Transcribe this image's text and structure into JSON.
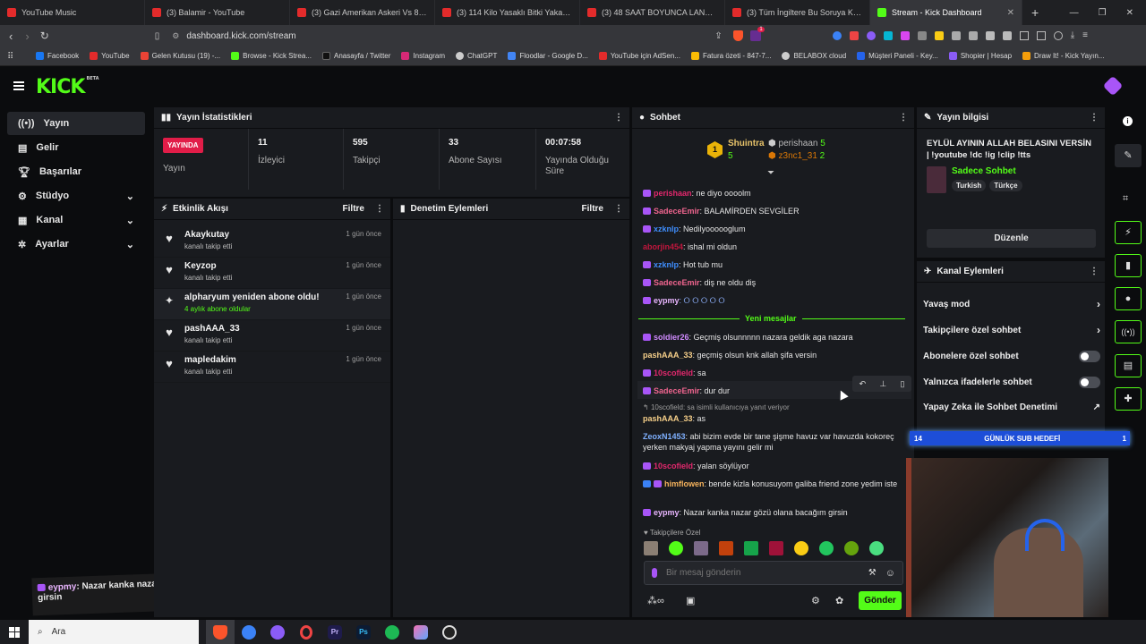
{
  "browser": {
    "tabs": [
      {
        "title": "YouTube Music",
        "active": false
      },
      {
        "title": "(3) Balamir - YouTube",
        "active": false
      },
      {
        "title": "(3) Gazi Amerikan Askeri Vs 8 Polis -",
        "active": false
      },
      {
        "title": "(3) 114 Kilo Yasaklı Bitki Yakalandı | G",
        "active": false
      },
      {
        "title": "(3) 48 SAAT BOYUNCA LANETLİ BİR Ç",
        "active": false
      },
      {
        "title": "(3) Tüm İngiltere Bu Soruya Kilitlend",
        "active": false
      },
      {
        "title": "Stream - Kick Dashboard",
        "active": true
      }
    ],
    "url": "dashboard.kick.com/stream",
    "bookmarks": [
      "Facebook",
      "YouTube",
      "Gelen Kutusu (19) -...",
      "Browse - Kick Strea...",
      "Anasayfa / Twitter",
      "Instagram",
      "ChatGPT",
      "Floodlar - Google D...",
      "YouTube için AdSen...",
      "Fatura özeti - 847-7...",
      "BELABOX cloud",
      "Müşteri Paneli - Key...",
      "Shopier | Hesap",
      "Draw It! - Kick Yayın..."
    ],
    "notification_count": "1"
  },
  "kick": {
    "logo": "KICK",
    "logo_sup": "BETA",
    "brand_color": "#53fc18"
  },
  "sidebar": {
    "items": [
      {
        "label": "Yayın",
        "icon": "broadcast-icon",
        "active": true
      },
      {
        "label": "Gelir",
        "icon": "wallet-icon"
      },
      {
        "label": "Başarılar",
        "icon": "trophy-icon"
      },
      {
        "label": "Stüdyo",
        "icon": "settings-icon",
        "expandable": true
      },
      {
        "label": "Kanal",
        "icon": "channel-icon",
        "expandable": true
      },
      {
        "label": "Ayarlar",
        "icon": "gear-icon",
        "expandable": true
      }
    ]
  },
  "stats": {
    "title": "Yayın İstatistikleri",
    "live_badge": "YAYINDA",
    "live_label": "Yayın",
    "items": [
      {
        "value": "11",
        "label": "İzleyici"
      },
      {
        "value": "595",
        "label": "Takipçi"
      },
      {
        "value": "33",
        "label": "Abone Sayısı"
      },
      {
        "value": "00:07:58",
        "label": "Yayında Olduğu Süre"
      }
    ]
  },
  "activity": {
    "title": "Etkinlik Akışı",
    "filter": "Filtre",
    "items": [
      {
        "name": "Akaykutay",
        "sub": "kanalı takip etti",
        "time": "1 gün önce",
        "icon": "heart-icon"
      },
      {
        "name": "Keyzop",
        "sub": "kanalı takip etti",
        "time": "1 gün önce",
        "icon": "heart-icon"
      },
      {
        "name": "alpharyum yeniden abone oldu!",
        "sub": "4 aylık abone oldular",
        "time": "1 gün önce",
        "icon": "sparkle-icon"
      },
      {
        "name": "pashAAA_33",
        "sub": "kanalı takip etti",
        "time": "1 gün önce",
        "icon": "heart-icon"
      },
      {
        "name": "mapledakim",
        "sub": "kanalı takip etti",
        "time": "1 gün önce",
        "icon": "heart-icon"
      }
    ]
  },
  "moderation": {
    "title": "Denetim Eylemleri",
    "filter": "Filtre"
  },
  "chat": {
    "title": "Sohbet",
    "leaderboard": [
      {
        "rank": "1",
        "name": "Shuintra",
        "count": "5"
      },
      {
        "rank": "",
        "name": "perishaan",
        "count": "5"
      },
      {
        "rank": "",
        "name": "z3nc1_31",
        "count": "2"
      }
    ],
    "messages": [
      {
        "user": "perishaan",
        "color": "#e3286d",
        "text": ": ne diyo oooolm",
        "badge": true
      },
      {
        "user": "SadeceEmir",
        "color": "#f0658f",
        "text": ": BALAMİRDEN SEVGİLER",
        "badge": true
      },
      {
        "user": "xzknlp",
        "color": "#3f8dfc",
        "text": ": Nedilyoooooglum",
        "badge": true
      },
      {
        "user": "aborjin454",
        "color": "#c0163d",
        "text": ": ishal mi oldun",
        "badge": false
      },
      {
        "user": "xzknlp",
        "color": "#3f8dfc",
        "text": ": Hot tub mu",
        "badge": true
      },
      {
        "user": "SadeceEmir",
        "color": "#f0658f",
        "text": ": diş ne oldu diş",
        "badge": true
      },
      {
        "user": "eypmy",
        "color": "#e9b6ff",
        "text": ": ⭘ ⭘ ⭘ ⭘ ⭘",
        "badge": true
      }
    ],
    "new_messages_label": "Yeni mesajlar",
    "messages2": [
      {
        "user": "soldier26",
        "color": "#d18cff",
        "text": ": Geçmiş olsunnnnn nazara geldik aga nazara",
        "badge": true
      },
      {
        "user": "pashAAA_33",
        "color": "#f7d08a",
        "text": ": geçmiş olsun knk allah şifa versin",
        "badge": false
      },
      {
        "user": "10scofield",
        "color": "#e3286d",
        "text": ": sa",
        "badge": true
      },
      {
        "user": "SadeceEmir",
        "color": "#f0658f",
        "text": ": dur dur",
        "badge": true
      }
    ],
    "reply_hint": "10scofield: sa isimli kullanıcıya yanıt veriyor",
    "messages3": [
      {
        "user": "pashAAA_33",
        "color": "#f7d08a",
        "text": ": as",
        "badge": false
      },
      {
        "user": "ZeoxN1453",
        "color": "#7fb0ff",
        "text": ": abi bizim evde bir tane şişme havuz var havuzda kokoreç yerken makyaj yapma yayını gelir mi",
        "badge": false
      },
      {
        "user": "10scofield",
        "color": "#e3286d",
        "text": ": yalan söylüyor",
        "badge": true
      },
      {
        "user": "himflowen",
        "color": "#f5b25c",
        "text": ": bende kizla konusuyom galiba friend zone yedim iste",
        "badge": true
      },
      {
        "user": "eypmy",
        "color": "#e9b6ff",
        "text": ": Nazar kanka nazar gözü olana bacağım girsin",
        "badge": true
      }
    ],
    "followers_only": "Takipçilere Özel",
    "input_placeholder": "Bir mesaj gönderin",
    "send": "Gönder"
  },
  "stream_info": {
    "title": "Yayın bilgisi",
    "stream_title": "EYLÜL AYININ ALLAH BELASINI VERSİN | !youtube !dc !ig !clip !tts",
    "category": "Sadece Sohbet",
    "tags": [
      "Turkish",
      "Türkçe"
    ],
    "edit": "Düzenle"
  },
  "channel_actions": {
    "title": "Kanal Eylemleri",
    "items": [
      {
        "label": "Yavaş mod",
        "control": "chevron"
      },
      {
        "label": "Takipçilere özel sohbet",
        "control": "chevron"
      },
      {
        "label": "Abonelere özel sohbet",
        "control": "toggle"
      },
      {
        "label": "Yalnızca ifadelerle sohbet",
        "control": "toggle"
      },
      {
        "label": "Yapay Zeka ile Sohbet Denetimi",
        "control": "external"
      }
    ]
  },
  "overlay": {
    "sub_goal_label": "GÜNLÜK SUB HEDEFİ",
    "sub_goal_left": "14",
    "sub_goal_right": "1",
    "chat_overlay_user": "eypmy",
    "chat_overlay_text": ": Nazar kanka nazar gözü olana bacağım girsin"
  },
  "taskbar": {
    "search": "Ara"
  }
}
